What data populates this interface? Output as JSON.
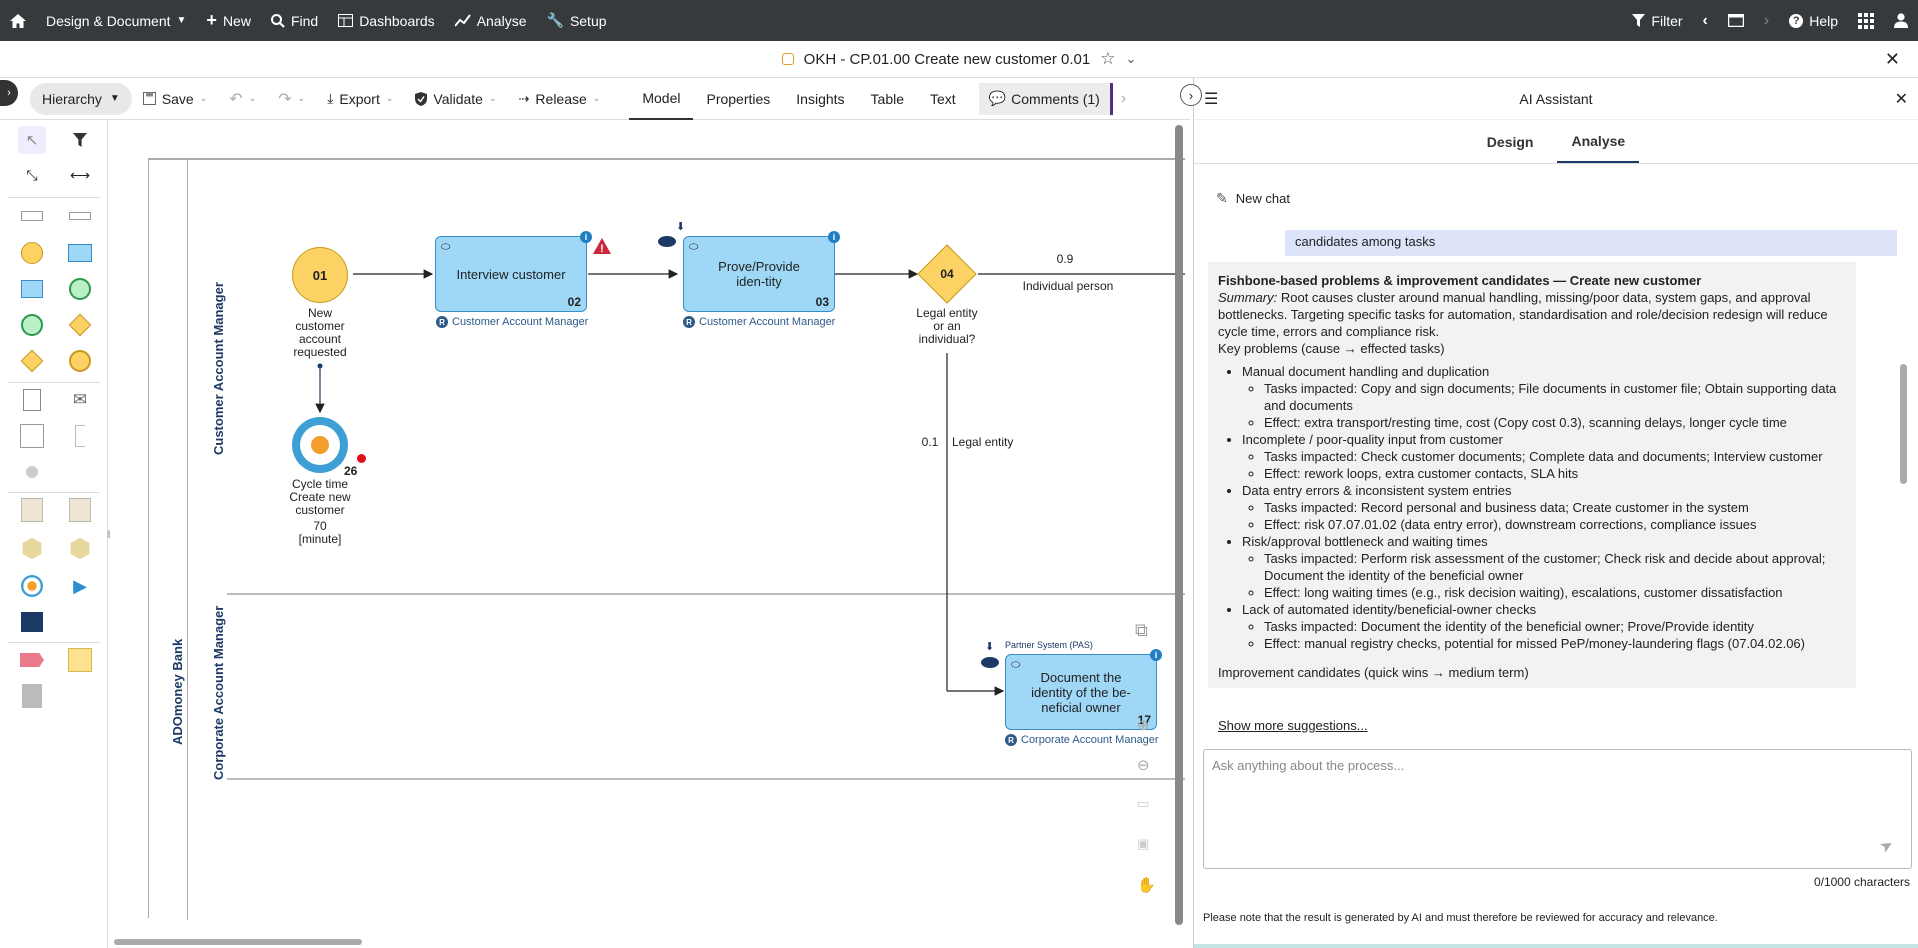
{
  "topbar": {
    "menu_design": "Design & Document",
    "menu_new": "New",
    "menu_find": "Find",
    "menu_dashboards": "Dashboards",
    "menu_analyse": "Analyse",
    "menu_setup": "Setup",
    "filter": "Filter",
    "help": "Help"
  },
  "titlebar": {
    "title": "OKH - CP.01.00 Create new customer 0.01"
  },
  "toolbar": {
    "hierarchy": "Hierarchy",
    "save": "Save",
    "export": "Export",
    "validate": "Validate",
    "release": "Release",
    "tabs": [
      "Model",
      "Properties",
      "Insights",
      "Table",
      "Text"
    ],
    "comments": "Comments (1)"
  },
  "diagram": {
    "pool_label": "ADOmoney Bank",
    "lane1": "Customer Account Manager",
    "lane2": "Corporate Account Manager",
    "start_num": "01",
    "start_label_1": "New",
    "start_label_2": "customer",
    "start_label_3": "account",
    "start_label_4": "requested",
    "task1": "Interview customer",
    "task1_num": "02",
    "task1_role": "Customer Account Manager",
    "task2": "Prove/Provide iden-tity",
    "task2_num": "03",
    "task2_role": "Customer Account Manager",
    "gateway_num": "04",
    "gateway_label_1": "Legal entity",
    "gateway_label_2": "or an",
    "gateway_label_3": "individual?",
    "edge_09": "0.9",
    "edge_individual": "Individual person",
    "edge_01": "0.1",
    "edge_legal": "Legal entity",
    "kpi_num": "26",
    "kpi_label_1": "Cycle time",
    "kpi_label_2": "Create new",
    "kpi_label_3": "customer",
    "kpi_label_4": "70",
    "kpi_label_5": "[minute]",
    "task3_system": "Partner System (PAS)",
    "task3": "Document the identity of the be-neficial owner",
    "task3_num": "17",
    "task3_role": "Corporate Account Manager"
  },
  "ai": {
    "title": "AI Assistant",
    "tab_design": "Design",
    "tab_analyse": "Analyse",
    "new_chat": "New chat",
    "user_msg": "candidates among tasks",
    "heading": "Fishbone-based problems & improvement candidates — Create new customer",
    "summary_label": "Summary:",
    "summary": "Root causes cluster around manual handling, missing/poor data, system gaps, and approval bottlenecks. Targeting specific tasks for automation, standardisation and role/decision redesign will reduce cycle time, errors and compliance risk.",
    "key_problems": "Key problems (cause → effected tasks)",
    "problems": [
      {
        "title": "Manual document handling and duplication",
        "tasks": "Tasks impacted: Copy and sign documents; File documents in customer file; Obtain supporting data and documents",
        "effect": "Effect: extra transport/resting time, cost (Copy cost 0.3), scanning delays, longer cycle time"
      },
      {
        "title": "Incomplete / poor-quality input from customer",
        "tasks": "Tasks impacted: Check customer documents; Complete data and documents; Interview customer",
        "effect": "Effect: rework loops, extra customer contacts, SLA hits"
      },
      {
        "title": "Data entry errors & inconsistent system entries",
        "tasks": "Tasks impacted: Record personal and business data; Create customer in the system",
        "effect": "Effect: risk 07.07.01.02 (data entry error), downstream corrections, compliance issues"
      },
      {
        "title": "Risk/approval bottleneck and waiting times",
        "tasks": "Tasks impacted: Perform risk assessment of the customer; Check risk and decide about approval; Document the identity of the beneficial owner",
        "effect": "Effect: long waiting times (e.g., risk decision waiting), escalations, customer dissatisfaction"
      },
      {
        "title": "Lack of automated identity/beneficial-owner checks",
        "tasks": "Tasks impacted: Document the identity of the beneficial owner; Prove/Provide identity",
        "effect": "Effect: manual registry checks, potential for missed PeP/money-laundering flags (07.04.02.06)"
      }
    ],
    "improvement": "Improvement candidates (quick wins → medium term)",
    "show_more": "Show more suggestions...",
    "input_placeholder": "Ask anything about the process...",
    "char_count": "0/1000 characters",
    "disclaimer": "Please note that the result is generated by AI and must therefore be reviewed for accuracy and relevance."
  }
}
